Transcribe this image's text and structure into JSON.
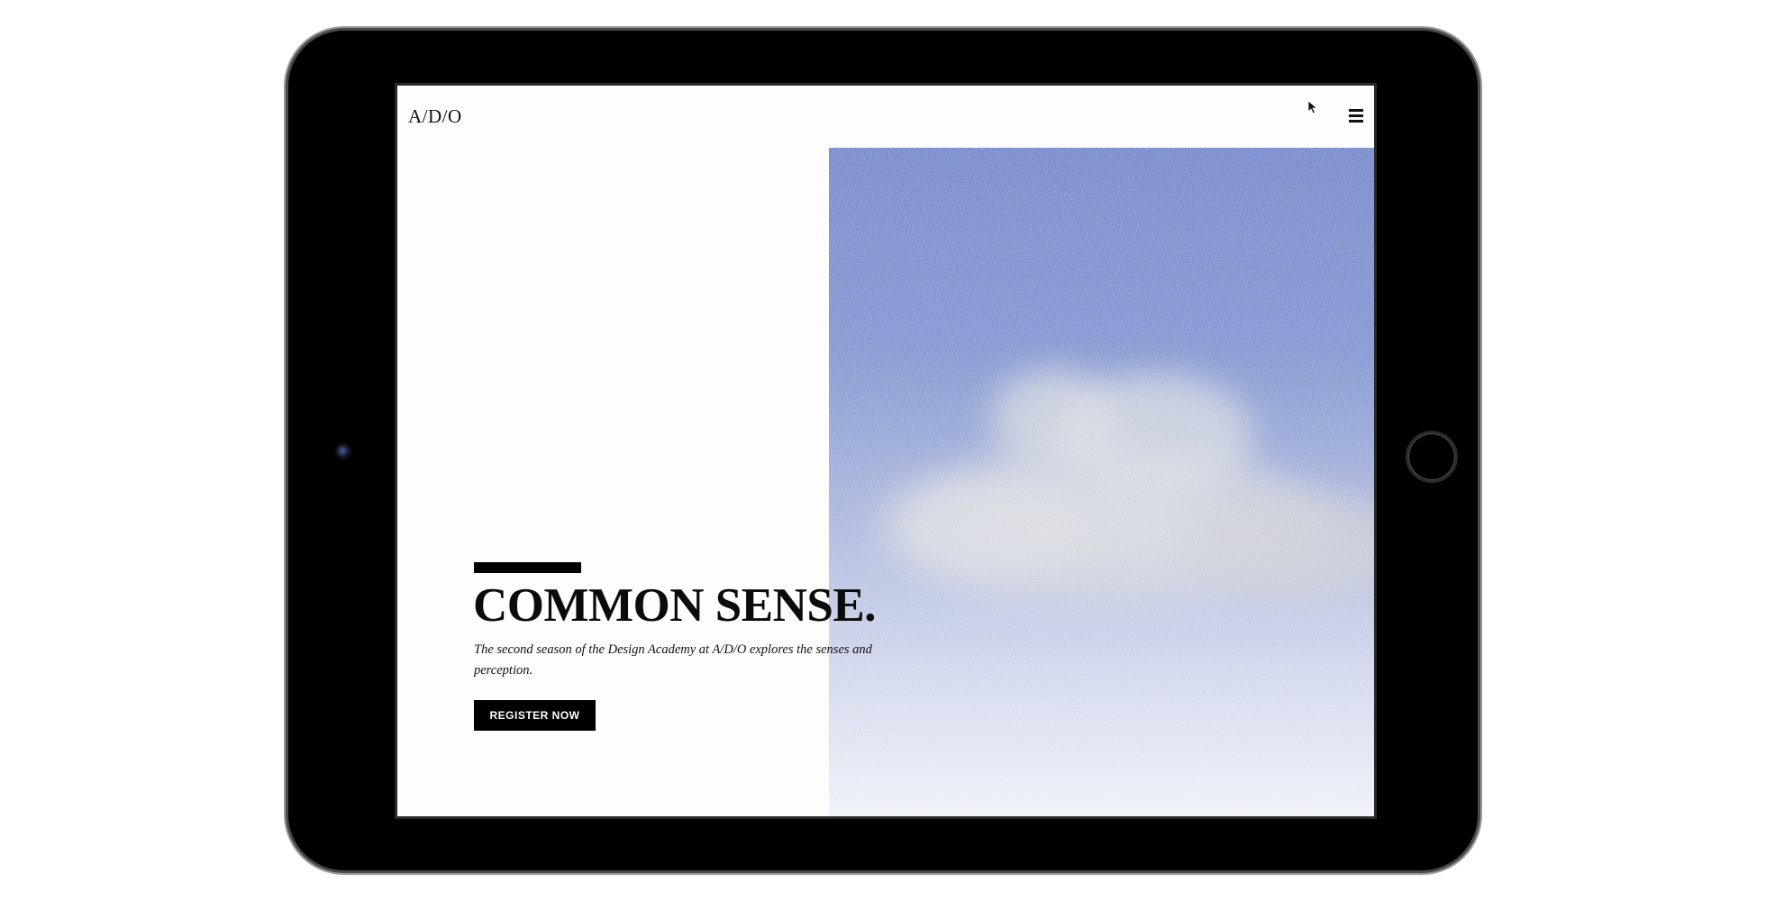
{
  "site": {
    "logo": "A/D/O"
  },
  "header": {
    "menu_icon": "hamburger-menu-icon",
    "cursor_icon": "mouse-pointer-icon"
  },
  "hero": {
    "headline": "COMMON SENSE.",
    "subtitle": "The second season of the Design Academy at A/D/O explores the senses and perception.",
    "cta_label": "REGISTER NOW"
  },
  "colors": {
    "noise_blue": "#3d5bb5",
    "cloud_gray": "#c4c6cc",
    "text": "#0b0b0b",
    "button_bg": "#000000",
    "button_text": "#ffffff",
    "device_frame": "#000000"
  }
}
